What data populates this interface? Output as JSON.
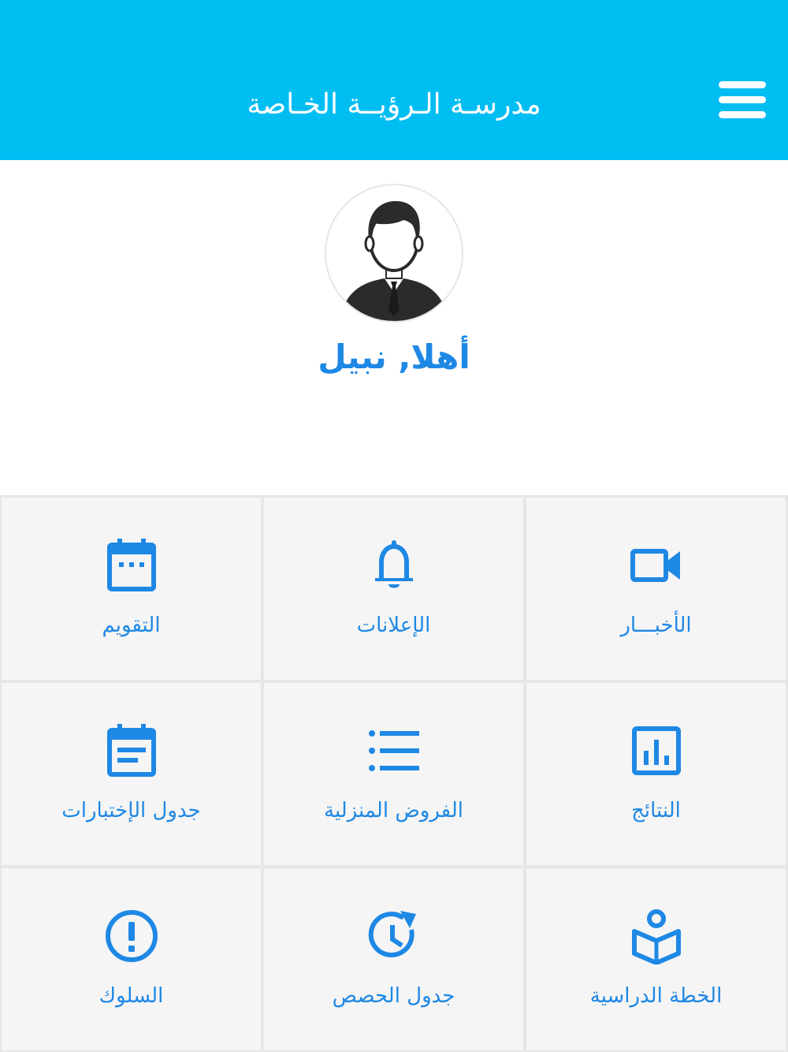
{
  "header": {
    "title": "مدرسـة الـرؤيــة الخـاصة",
    "menu_icon": "hamburger-menu-icon",
    "background_color": "#00bdf2"
  },
  "profile": {
    "avatar_icon": "user-avatar-icon",
    "greeting": "أهلا, نبيل"
  },
  "accent_color": "#1e88e5",
  "tiles": [
    {
      "label": "الأخبـــار",
      "icon": "video-camera-icon"
    },
    {
      "label": "الإعلانات",
      "icon": "bell-icon"
    },
    {
      "label": "التقويم",
      "icon": "calendar-icon"
    },
    {
      "label": "النتائج",
      "icon": "bar-chart-icon"
    },
    {
      "label": "الفروض المنزلية",
      "icon": "list-icon"
    },
    {
      "label": "جدول الإختبارات",
      "icon": "calendar-notes-icon"
    },
    {
      "label": "الخطة الدراسية",
      "icon": "book-reader-icon"
    },
    {
      "label": "جدول الحصص",
      "icon": "clock-refresh-icon"
    },
    {
      "label": "السلوك",
      "icon": "alert-circle-icon"
    }
  ]
}
